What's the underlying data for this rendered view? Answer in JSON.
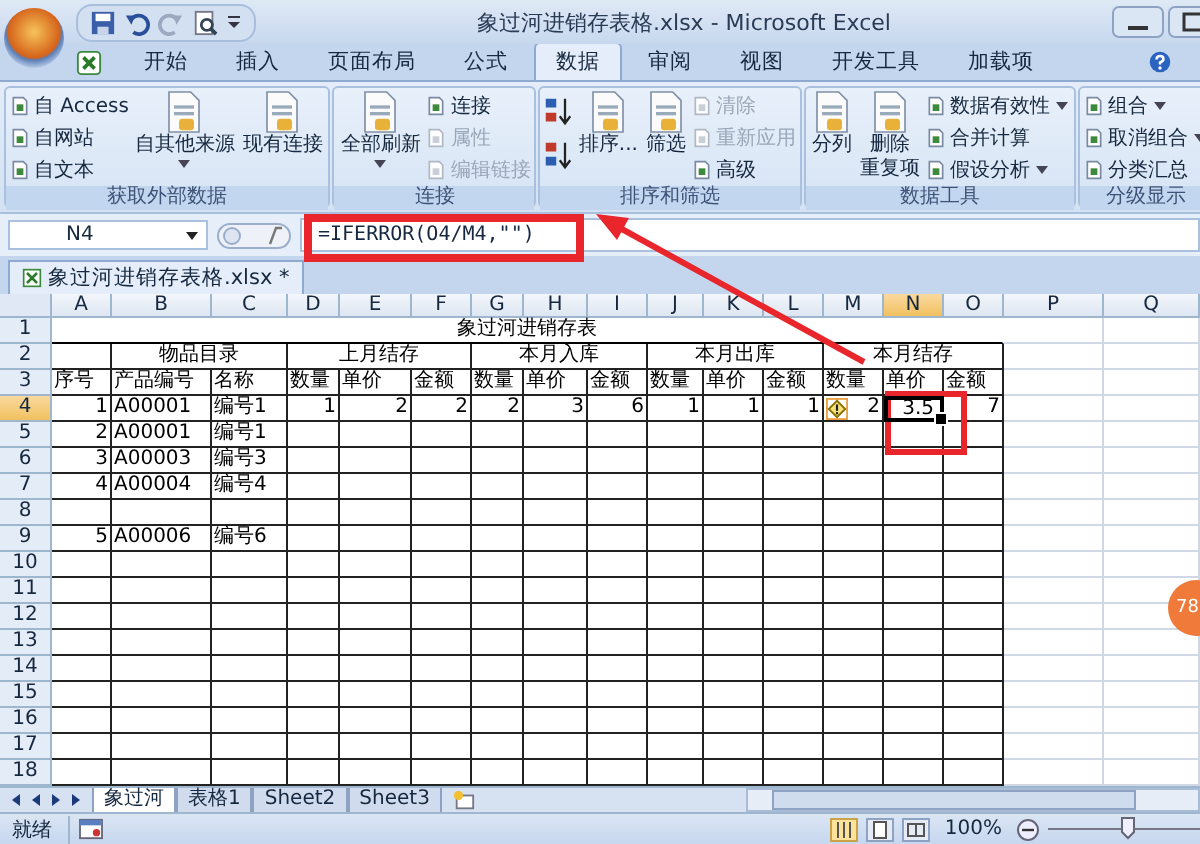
{
  "window": {
    "title": "象过河进销存表格.xlsx - Microsoft Excel"
  },
  "ribbon_tabs": [
    {
      "label": "开始",
      "selected": false
    },
    {
      "label": "插入",
      "selected": false
    },
    {
      "label": "页面布局",
      "selected": false
    },
    {
      "label": "公式",
      "selected": false
    },
    {
      "label": "数据",
      "selected": true
    },
    {
      "label": "审阅",
      "selected": false
    },
    {
      "label": "视图",
      "selected": false
    },
    {
      "label": "开发工具",
      "selected": false
    },
    {
      "label": "加载项",
      "selected": false
    }
  ],
  "ribbon_groups": [
    {
      "label": "获取外部数据",
      "items": [
        {
          "kind": "small",
          "label": "自 Access",
          "disabled": false,
          "dropdown": false
        },
        {
          "kind": "small",
          "label": "自网站",
          "disabled": false,
          "dropdown": false
        },
        {
          "kind": "small",
          "label": "自文本",
          "disabled": false,
          "dropdown": false
        },
        {
          "kind": "large",
          "lines": [
            "自其他来源"
          ],
          "disabled": false,
          "dropdown": true
        },
        {
          "kind": "large",
          "lines": [
            "现有连接"
          ],
          "disabled": false,
          "dropdown": false
        }
      ]
    },
    {
      "label": "连接",
      "items": [
        {
          "kind": "large",
          "lines": [
            "全部刷新"
          ],
          "disabled": false,
          "dropdown": true
        },
        {
          "kind": "small",
          "label": "连接",
          "disabled": false,
          "dropdown": false
        },
        {
          "kind": "small",
          "label": "属性",
          "disabled": true,
          "dropdown": false
        },
        {
          "kind": "small",
          "label": "编辑链接",
          "disabled": true,
          "dropdown": false
        }
      ]
    },
    {
      "label": "排序和筛选",
      "items": [
        {
          "kind": "sort_asc"
        },
        {
          "kind": "sort_desc"
        },
        {
          "kind": "large",
          "lines": [
            "排序..."
          ],
          "disabled": false,
          "dropdown": false
        },
        {
          "kind": "large",
          "lines": [
            "筛选"
          ],
          "disabled": false,
          "dropdown": false
        },
        {
          "kind": "small",
          "label": "清除",
          "disabled": true,
          "dropdown": false
        },
        {
          "kind": "small",
          "label": "重新应用",
          "disabled": true,
          "dropdown": false
        },
        {
          "kind": "small",
          "label": "高级",
          "disabled": false,
          "dropdown": false
        }
      ]
    },
    {
      "label": "数据工具",
      "items": [
        {
          "kind": "large",
          "lines": [
            "分列"
          ],
          "disabled": false,
          "dropdown": false
        },
        {
          "kind": "large",
          "lines": [
            "删除",
            "重复项"
          ],
          "disabled": false,
          "dropdown": false
        },
        {
          "kind": "small",
          "label": "数据有效性",
          "disabled": false,
          "dropdown": true
        },
        {
          "kind": "small",
          "label": "合并计算",
          "disabled": false,
          "dropdown": false
        },
        {
          "kind": "small",
          "label": "假设分析",
          "disabled": false,
          "dropdown": true
        }
      ]
    },
    {
      "label": "分级显示",
      "items": [
        {
          "kind": "small",
          "label": "组合",
          "disabled": false,
          "dropdown": true
        },
        {
          "kind": "small",
          "label": "取消组合",
          "disabled": false,
          "dropdown": true
        },
        {
          "kind": "small",
          "label": "分类汇总",
          "disabled": false,
          "dropdown": false
        }
      ]
    }
  ],
  "name_box": "N4",
  "formula": "=IFERROR(O4/M4,\"\")",
  "workbook_tab": "象过河进销存表格.xlsx *",
  "columns": [
    {
      "label": "A",
      "selected": false
    },
    {
      "label": "B",
      "selected": false
    },
    {
      "label": "C",
      "selected": false
    },
    {
      "label": "D",
      "selected": false
    },
    {
      "label": "E",
      "selected": false
    },
    {
      "label": "F",
      "selected": false
    },
    {
      "label": "G",
      "selected": false
    },
    {
      "label": "H",
      "selected": false
    },
    {
      "label": "I",
      "selected": false
    },
    {
      "label": "J",
      "selected": false
    },
    {
      "label": "K",
      "selected": false
    },
    {
      "label": "L",
      "selected": false
    },
    {
      "label": "M",
      "selected": false
    },
    {
      "label": "N",
      "selected": true
    },
    {
      "label": "O",
      "selected": false
    },
    {
      "label": "P",
      "selected": false
    },
    {
      "label": "Q",
      "selected": false
    }
  ],
  "sheet_title": "象过河进销存表",
  "header_groups": [
    {
      "columns": [
        "序号"
      ]
    },
    {
      "label": "物品目录",
      "columns": [
        "产品编号",
        "名称"
      ]
    },
    {
      "label": "上月结存",
      "columns": [
        "数量",
        "单价",
        "金额"
      ]
    },
    {
      "label": "本月入库",
      "columns": [
        "数量",
        "单价",
        "金额"
      ]
    },
    {
      "label": "本月出库",
      "columns": [
        "数量",
        "单价",
        "金额"
      ]
    },
    {
      "label": "本月结存",
      "columns": [
        "数量",
        "单价",
        "金额"
      ]
    }
  ],
  "rows": [
    {
      "label": "1",
      "selected": false
    },
    {
      "label": "2",
      "selected": false
    },
    {
      "label": "3",
      "selected": false
    },
    {
      "label": "4",
      "selected": true,
      "cells": [
        {
          "kind": "num",
          "text": "1"
        },
        {
          "kind": "text",
          "text": "A00001"
        },
        {
          "kind": "text",
          "text": "编号1"
        },
        {
          "kind": "num",
          "text": "1"
        },
        {
          "kind": "num",
          "text": "2"
        },
        {
          "kind": "num",
          "text": "2"
        },
        {
          "kind": "num",
          "text": "2"
        },
        {
          "kind": "num",
          "text": "3"
        },
        {
          "kind": "num",
          "text": "6"
        },
        {
          "kind": "num",
          "text": "1"
        },
        {
          "kind": "num",
          "text": "1"
        },
        {
          "kind": "num",
          "text": "1"
        },
        {
          "kind": "flagged",
          "text": "2"
        },
        {
          "kind": "num",
          "text": "3.5"
        },
        {
          "kind": "num",
          "text": "7"
        }
      ]
    },
    {
      "label": "5",
      "selected": false,
      "cells": [
        {
          "kind": "num",
          "text": "2"
        },
        {
          "kind": "text",
          "text": "A00001"
        },
        {
          "kind": "text",
          "text": "编号1"
        }
      ]
    },
    {
      "label": "6",
      "selected": false,
      "cells": [
        {
          "kind": "num",
          "text": "3"
        },
        {
          "kind": "text",
          "text": "A00003"
        },
        {
          "kind": "text",
          "text": "编号3"
        }
      ]
    },
    {
      "label": "7",
      "selected": false,
      "cells": [
        {
          "kind": "num",
          "text": "4"
        },
        {
          "kind": "text",
          "text": "A00004"
        },
        {
          "kind": "text",
          "text": "编号4"
        }
      ]
    },
    {
      "label": "8",
      "selected": false
    },
    {
      "label": "9",
      "selected": false,
      "cells": [
        {
          "kind": "num",
          "text": "5"
        },
        {
          "kind": "text",
          "text": "A00006"
        },
        {
          "kind": "text",
          "text": "编号6"
        }
      ]
    },
    {
      "label": "10",
      "selected": false
    },
    {
      "label": "11",
      "selected": false
    },
    {
      "label": "12",
      "selected": false
    },
    {
      "label": "13",
      "selected": false
    },
    {
      "label": "14",
      "selected": false
    },
    {
      "label": "15",
      "selected": false
    },
    {
      "label": "16",
      "selected": false
    },
    {
      "label": "17",
      "selected": false
    },
    {
      "label": "18",
      "selected": false
    }
  ],
  "sheet_tabs": [
    {
      "label": "象过河",
      "selected": true
    },
    {
      "label": "表格1",
      "selected": false
    },
    {
      "label": "Sheet2",
      "selected": false
    },
    {
      "label": "Sheet3",
      "selected": false
    }
  ],
  "status_bar": {
    "text": "就绪",
    "zoom": "100%",
    "zoom_slider": {
      "level": 0.5
    }
  },
  "badge": "78"
}
